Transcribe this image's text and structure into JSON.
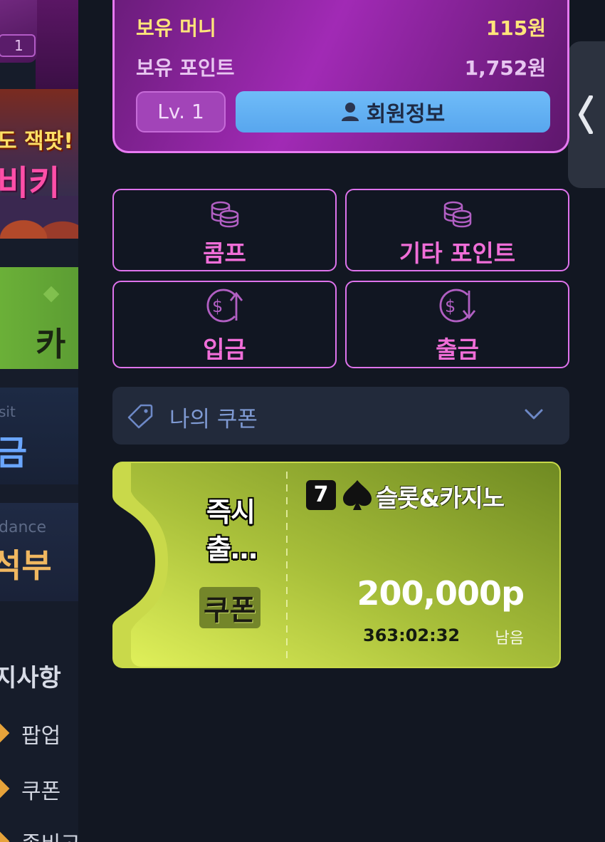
{
  "background": {
    "avatar_level": "1",
    "promo_line1": "도 잭팟!",
    "promo_line2": "비키",
    "green_text": "카",
    "deposit_sub": "sit",
    "deposit_title": "금",
    "attendance_sub": "dance",
    "attendance_title": "석부",
    "notice_title": "지사항",
    "notice_items": [
      "팝업",
      "쿠폰",
      "종비고"
    ]
  },
  "profile": {
    "money_label": "보유 머니",
    "money_value": "115원",
    "points_label": "보유 포인트",
    "points_value": "1,752원",
    "level_button": "Lv. 1",
    "member_button": "회원정보",
    "member_icon": "person-icon"
  },
  "actions": [
    {
      "label": "콤프",
      "icon": "coins-icon"
    },
    {
      "label": "기타 포인트",
      "icon": "coins-icon"
    },
    {
      "label": "입금",
      "icon": "dollar-up-icon"
    },
    {
      "label": "출금",
      "icon": "dollar-down-icon"
    }
  ],
  "coupon_section": {
    "label": "나의 쿠폰",
    "icon": "tag-icon"
  },
  "coupon": {
    "title_line1": "즉시",
    "title_line2": "출…",
    "badge": "쿠폰",
    "badge_number": "7",
    "game": "슬롯&카지노",
    "amount": "200,000p",
    "time_left": "363:02:32",
    "remain_label": "남음"
  },
  "colors": {
    "accent_pink": "#e77af2",
    "member_blue": "#5fb0f4",
    "money_yellow": "#ffe57a",
    "coupon_green": "#a9c23a"
  }
}
